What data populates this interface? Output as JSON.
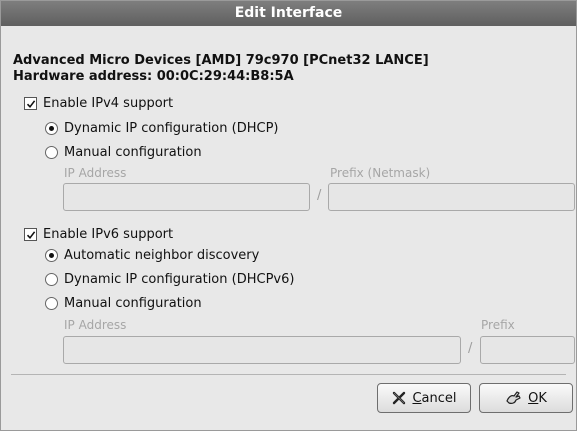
{
  "window": {
    "title": "Edit Interface"
  },
  "device": {
    "name": "Advanced Micro Devices [AMD] 79c970 [PCnet32 LANCE]",
    "hardware_address": "Hardware address: 00:0C:29:44:B8:5A"
  },
  "ipv4": {
    "enable_label": "Enable IPv4 support",
    "enabled": true,
    "options": [
      {
        "label": "Dynamic IP configuration (DHCP)",
        "selected": true
      },
      {
        "label": "Manual configuration",
        "selected": false
      }
    ],
    "ip_address_label": "IP Address",
    "prefix_label": "Prefix (Netmask)",
    "ip_address_value": "",
    "prefix_value": "",
    "separator": "/"
  },
  "ipv6": {
    "enable_label": "Enable IPv6 support",
    "enabled": true,
    "options": [
      {
        "label": "Automatic neighbor discovery",
        "selected": true
      },
      {
        "label": "Dynamic IP configuration (DHCPv6)",
        "selected": false
      },
      {
        "label": "Manual configuration",
        "selected": false
      }
    ],
    "ip_address_label": "IP Address",
    "prefix_label": "Prefix",
    "ip_address_value": "",
    "prefix_value": "",
    "separator": "/"
  },
  "buttons": {
    "cancel_mnemonic": "C",
    "cancel_rest": "ancel",
    "cancel_icon": "cancel-x-icon",
    "ok_mnemonic": "O",
    "ok_rest": "K",
    "ok_icon": "ok-hand-icon"
  }
}
